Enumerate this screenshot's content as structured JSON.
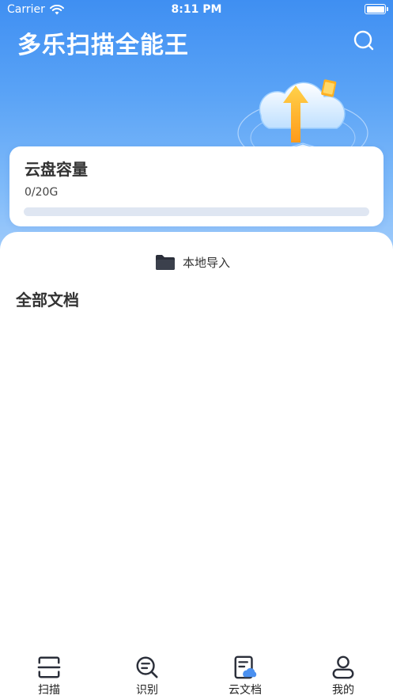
{
  "status_bar": {
    "carrier": "Carrier",
    "time": "8:11 PM"
  },
  "header": {
    "title": "多乐扫描全能王"
  },
  "capacity": {
    "title": "云盘容量",
    "value": "0/20G",
    "used_fraction": 0
  },
  "content": {
    "import_label": "本地导入",
    "section_title": "全部文档"
  },
  "tabs": [
    {
      "label": "扫描",
      "icon": "scan-icon",
      "active": false
    },
    {
      "label": "识别",
      "icon": "recognize-icon",
      "active": false
    },
    {
      "label": "云文档",
      "icon": "cloud-doc-icon",
      "active": true
    },
    {
      "label": "我的",
      "icon": "profile-icon",
      "active": false
    }
  ],
  "colors": {
    "primary": "#3f8ff2",
    "accent": "#4a90f0",
    "icon_dark": "#2b2f3a"
  }
}
